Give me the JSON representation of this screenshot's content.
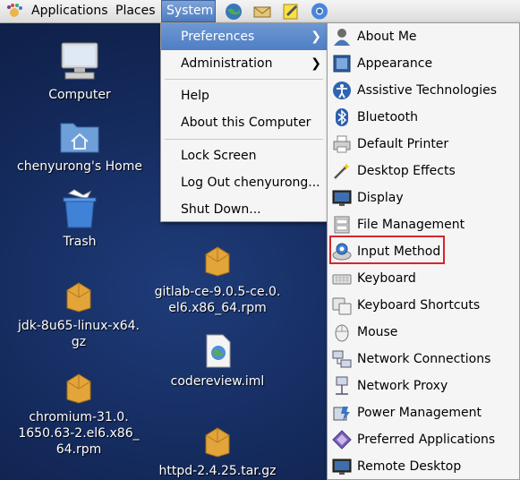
{
  "panel": {
    "menus": [
      "Applications",
      "Places",
      "System"
    ],
    "active_menu": "System",
    "launchers": [
      "web-browser-icon",
      "mail-client-icon",
      "notes-icon",
      "chromium-icon"
    ]
  },
  "desktop": {
    "computer": "Computer",
    "home": "chenyurong's Home",
    "trash": "Trash",
    "jdk": "jdk-8u65-linux-x64.\ngz",
    "chromium": "chromium-31.0.\n1650.63-2.el6.x86_\n64.rpm",
    "gitlab": "gitlab-ce-9.0.5-ce.0.\nel6.x86_64.rpm",
    "codereview": "codereview.iml",
    "httpd": "httpd-2.4.25.tar.gz"
  },
  "system_menu": {
    "preferences": "Preferences",
    "administration": "Administration",
    "help": "Help",
    "about": "About this Computer",
    "lock": "Lock Screen",
    "logout": "Log Out chenyurong...",
    "shutdown": "Shut Down..."
  },
  "preferences_menu": [
    {
      "label": "About Me",
      "icon": "about-me-icon"
    },
    {
      "label": "Appearance",
      "icon": "appearance-icon"
    },
    {
      "label": "Assistive Technologies",
      "icon": "accessibility-icon"
    },
    {
      "label": "Bluetooth",
      "icon": "bluetooth-icon"
    },
    {
      "label": "Default Printer",
      "icon": "printer-icon"
    },
    {
      "label": "Desktop Effects",
      "icon": "desktop-effects-icon"
    },
    {
      "label": "Display",
      "icon": "display-icon"
    },
    {
      "label": "File Management",
      "icon": "file-management-icon"
    },
    {
      "label": "Input Method",
      "icon": "input-method-icon"
    },
    {
      "label": "Keyboard",
      "icon": "keyboard-icon"
    },
    {
      "label": "Keyboard Shortcuts",
      "icon": "keyboard-shortcuts-icon"
    },
    {
      "label": "Mouse",
      "icon": "mouse-icon"
    },
    {
      "label": "Network Connections",
      "icon": "network-connections-icon"
    },
    {
      "label": "Network Proxy",
      "icon": "network-proxy-icon"
    },
    {
      "label": "Power Management",
      "icon": "power-management-icon"
    },
    {
      "label": "Preferred Applications",
      "icon": "preferred-applications-icon"
    },
    {
      "label": "Remote Desktop",
      "icon": "remote-desktop-icon"
    }
  ],
  "highlighted_item": "Input Method",
  "colors": {
    "highlight_border": "#d6262a",
    "menu_active": "#4e7ec4",
    "desktop": "#142a5c"
  }
}
